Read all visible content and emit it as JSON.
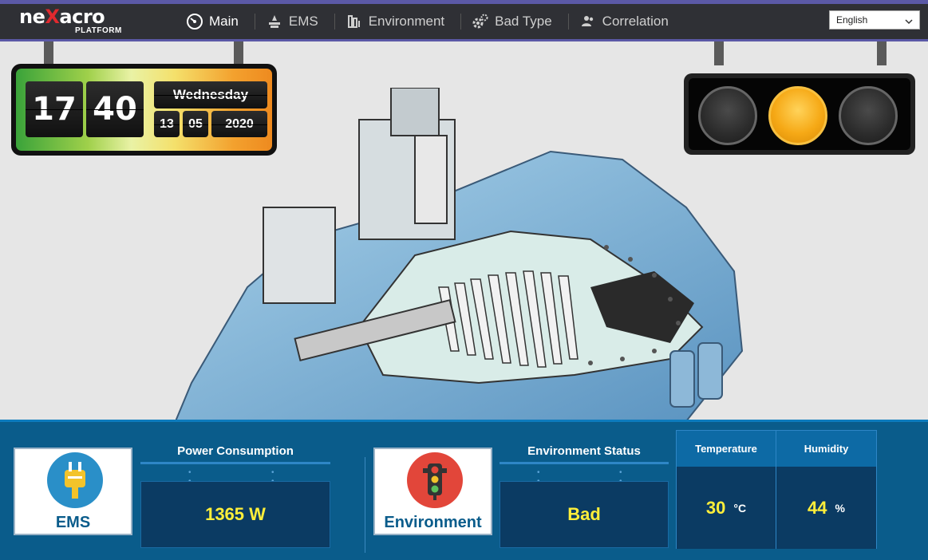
{
  "header": {
    "logo_main_a": "ne",
    "logo_main_x": "X",
    "logo_main_b": "acro",
    "logo_sub": "PLATFORM",
    "nav": [
      {
        "label": "Main",
        "icon": "speedometer-icon"
      },
      {
        "label": "EMS",
        "icon": "ems-icon"
      },
      {
        "label": "Environment",
        "icon": "building-icon"
      },
      {
        "label": "Bad Type",
        "icon": "gears-icon"
      },
      {
        "label": "Correlation",
        "icon": "users-icon"
      }
    ],
    "language": "English"
  },
  "clock": {
    "hour": "17",
    "minute": "40",
    "day": "Wednesday",
    "date_day": "13",
    "date_month": "05",
    "date_year": "2020"
  },
  "traffic_light": {
    "active": "yellow",
    "colors": {
      "on": "#f6a916",
      "off": "#2b2b2b"
    }
  },
  "ems": {
    "card_label": "EMS",
    "title": "Power Consumption",
    "value": "1365 W"
  },
  "environment": {
    "card_label": "Environment",
    "title": "Environment Status",
    "value": "Bad",
    "temperature_label": "Temperature",
    "humidity_label": "Humidity",
    "temperature_value": "30",
    "temperature_unit": "°C",
    "humidity_value": "44",
    "humidity_unit": "%"
  },
  "colors": {
    "header_bg": "#2f3035",
    "accent": "#5b59a6",
    "panel_bg": "#0a5c8b",
    "value_text": "#ffef3a"
  }
}
